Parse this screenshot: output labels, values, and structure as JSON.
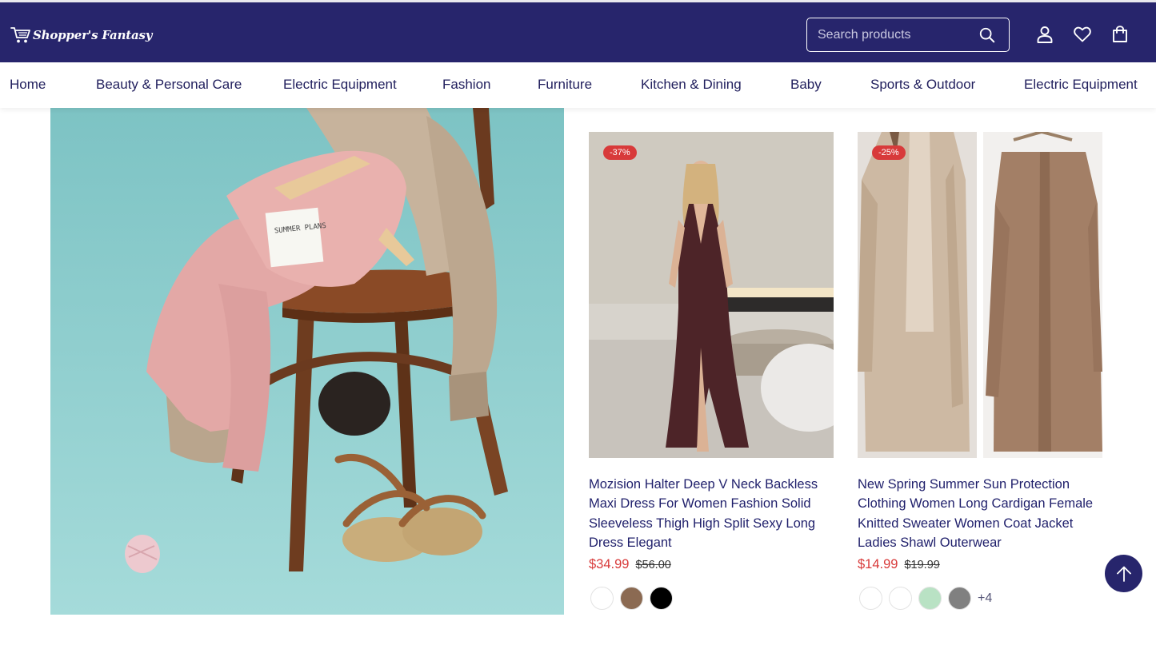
{
  "header": {
    "logo_text": "Shopper's Fantasy",
    "search_placeholder": "Search products",
    "colors": {
      "header_bg": "#27256c",
      "accent": "#d83a3a"
    },
    "icons": [
      "cart-icon",
      "search-icon",
      "user-icon",
      "heart-icon",
      "bag-icon"
    ]
  },
  "nav": {
    "items": [
      {
        "label": "Home"
      },
      {
        "label": "Beauty & Personal Care"
      },
      {
        "label": "Electric Equipment"
      },
      {
        "label": "Fashion"
      },
      {
        "label": "Furniture"
      },
      {
        "label": "Kitchen & Dining"
      },
      {
        "label": "Baby"
      },
      {
        "label": "Sports & Outdoor"
      },
      {
        "label": "Electric Equipment"
      }
    ]
  },
  "products": [
    {
      "badge": "-37%",
      "title": "Mozision Halter Deep V Neck Backless Maxi Dress For Women Fashion Solid Sleeveless Thigh High Split Sexy Long Dress Elegant",
      "price": "$34.99",
      "old_price": "$56.00",
      "swatches": [
        "#ffffff",
        "#8b6a52",
        "#000000"
      ]
    },
    {
      "badge": "-25%",
      "title": "New Spring Summer Sun Protection Clothing Women Long Cardigan Female Knitted Sweater Women Coat Jacket Ladies Shawl Outerwear",
      "price": "$14.99",
      "old_price": "$19.99",
      "swatches": [
        "#ffffff",
        "#ffffff",
        "#b9e2c4",
        "#808080"
      ],
      "more_colors": "+4"
    }
  ]
}
